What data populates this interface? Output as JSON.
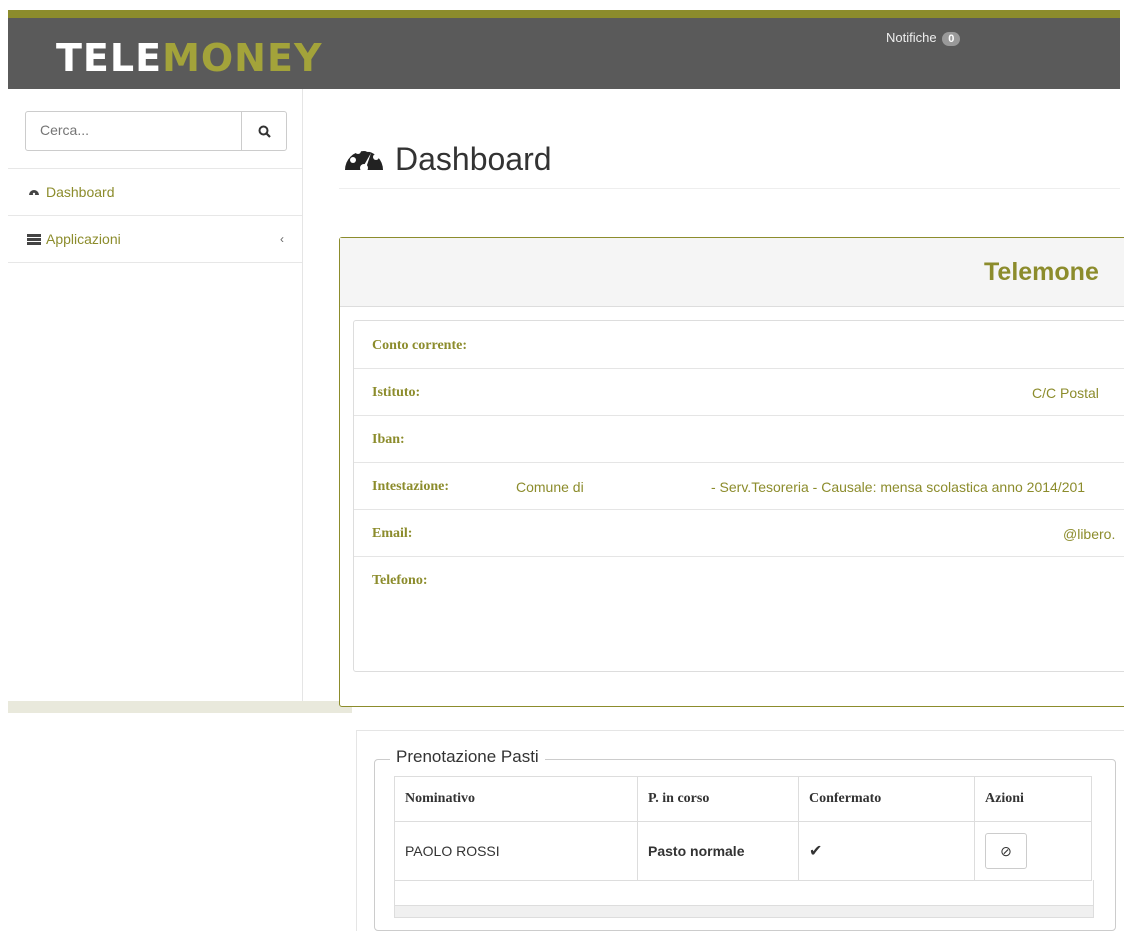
{
  "header": {
    "logo_part1": "TELE",
    "logo_part2": "MONEY",
    "notifications_label": "Notifiche",
    "notifications_count": "0"
  },
  "sidebar": {
    "search_placeholder": "Cerca...",
    "items": [
      {
        "label": "Dashboard",
        "icon": "dashboard-icon"
      },
      {
        "label": "Applicazioni",
        "icon": "list-icon"
      }
    ]
  },
  "main": {
    "page_title": "Dashboard",
    "panel_title": "Telemone",
    "info_rows": [
      {
        "label": "Conto corrente:",
        "value": ""
      },
      {
        "label": "Istituto:",
        "value": "C/C Postal"
      },
      {
        "label": "Iban:",
        "value": ""
      },
      {
        "label": "Intestazione:",
        "value_a": "Comune di",
        "value_b": "- Serv.Tesoreria - Causale: mensa scolastica anno 2014/201"
      },
      {
        "label": "Email:",
        "value": "@libero."
      },
      {
        "label": "Telefono:",
        "value": ""
      }
    ]
  },
  "prenotazione": {
    "legend": "Prenotazione Pasti",
    "columns": [
      "Nominativo",
      "P. in corso",
      "Confermato",
      "Azioni"
    ],
    "rows": [
      {
        "nominativo": "PAOLO ROSSI",
        "pasto": "Pasto normale",
        "confermato": "✔",
        "azione_icon": "⊘"
      }
    ]
  },
  "colors": {
    "accent": "#8c8c2c",
    "header_bg": "#5a5a5a"
  }
}
